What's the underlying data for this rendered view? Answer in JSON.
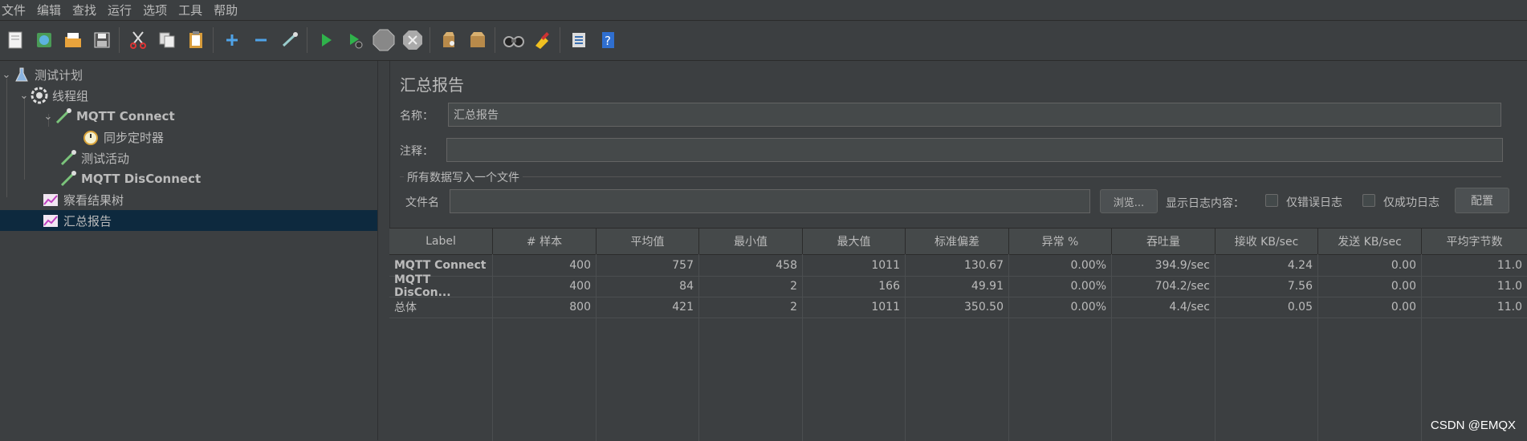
{
  "menu": [
    "文件",
    "编辑",
    "查找",
    "运行",
    "选项",
    "工具",
    "帮助"
  ],
  "toolbar": {
    "icons": [
      "new-icon",
      "templates-icon",
      "open-icon",
      "save-icon",
      "cut-icon",
      "copy-icon",
      "paste-icon",
      "add-icon",
      "remove-icon",
      "toggle-icon",
      "start-icon",
      "start-no-pause-icon",
      "stop-icon",
      "shutdown-icon",
      "clear-icon",
      "clear-all-icon",
      "search-icon",
      "reset-search-icon",
      "function-helper-icon",
      "help-icon"
    ]
  },
  "tree": {
    "items": [
      {
        "label": "测试计划",
        "icon": "test-plan-icon"
      },
      {
        "label": "线程组",
        "icon": "thread-group-icon"
      },
      {
        "label": "MQTT Connect",
        "icon": "sampler-icon"
      },
      {
        "label": "同步定时器",
        "icon": "timer-icon"
      },
      {
        "label": "测试活动",
        "icon": "sampler-icon"
      },
      {
        "label": "MQTT DisConnect",
        "icon": "sampler-icon"
      },
      {
        "label": "察看结果树",
        "icon": "listener-icon"
      },
      {
        "label": "汇总报告",
        "icon": "listener-icon"
      }
    ]
  },
  "panel": {
    "title": "汇总报告",
    "name_label": "名称：",
    "name_value": "汇总报告",
    "comment_label": "注释：",
    "comment_value": "",
    "group_title": "所有数据写入一个文件",
    "filename_label": "文件名",
    "filename_value": "",
    "browse_label": "浏览...",
    "log_label": "显示日志内容：",
    "errors_only_label": "仅错误日志",
    "success_only_label": "仅成功日志",
    "configure_label": "配置"
  },
  "table": {
    "headers": [
      "Label",
      "# 样本",
      "平均值",
      "最小值",
      "最大值",
      "标准偏差",
      "异常 %",
      "吞吐量",
      "接收 KB/sec",
      "发送 KB/sec",
      "平均字节数"
    ],
    "rows": [
      [
        "MQTT Connect",
        "400",
        "757",
        "458",
        "1011",
        "130.67",
        "0.00%",
        "394.9/sec",
        "4.24",
        "0.00",
        "11.0"
      ],
      [
        "MQTT DisCon...",
        "400",
        "84",
        "2",
        "166",
        "49.91",
        "0.00%",
        "704.2/sec",
        "7.56",
        "0.00",
        "11.0"
      ],
      [
        "总体",
        "800",
        "421",
        "2",
        "1011",
        "350.50",
        "0.00%",
        "4.4/sec",
        "0.05",
        "0.00",
        "11.0"
      ]
    ]
  },
  "watermark": "CSDN @EMQX",
  "colors": {
    "background": "#3c3f41",
    "selection": "#0d293e",
    "text": "#bbbbbb"
  }
}
